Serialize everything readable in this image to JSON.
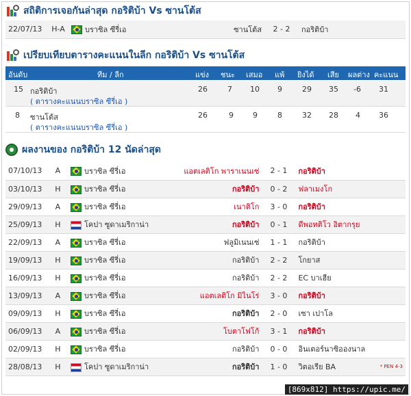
{
  "recent_meeting": {
    "title": "สถิติการเจอกันล่าสุด กอริติบ้า Vs ซานโต้ส",
    "match": {
      "date": "22/07/13",
      "ha": "H-A",
      "league": "บราซิล ซีรี่เอ",
      "home": "ซานโต้ส",
      "score": "2 - 2",
      "away": "กอริติบ้า"
    }
  },
  "standings": {
    "title": "เปรียบเทียบตารางคะแนนในลีก กอริติบ้า Vs ซานโต้ส",
    "headers": {
      "rank": "อันดับ",
      "team": "ทีม / ลีก",
      "played": "แข่ง",
      "win": "ชนะ",
      "draw": "เสมอ",
      "lose": "แพ้",
      "gf": "ยิงได้",
      "ga": "เสีย",
      "gd": "ผลต่าง",
      "pts": "คะแนน"
    },
    "rows": [
      {
        "rank": "15",
        "team": "กอริติบ้า",
        "link": "( ตารางคะแนนบราซิล ซีรี่เอ )",
        "played": "26",
        "win": "7",
        "draw": "10",
        "lose": "9",
        "gf": "29",
        "ga": "35",
        "gd": "-6",
        "pts": "31"
      },
      {
        "rank": "8",
        "team": "ซานโต้ส",
        "link": "( ตารางคะแนนบราซิล ซีรี่เอ )",
        "played": "26",
        "win": "9",
        "draw": "9",
        "lose": "8",
        "gf": "32",
        "ga": "28",
        "gd": "4",
        "pts": "36"
      }
    ]
  },
  "last12": {
    "title": "ผลงานของ กอริติบ้า 12 นัดล่าสุด",
    "rows": [
      {
        "date": "07/10/13",
        "ha": "A",
        "flag": "brazil-flag",
        "league": "บราซิล ซีรี่เอ",
        "home": "แอตเลติโก พาราเนนเซ่",
        "score": "2 - 1",
        "away": "กอริติบ้า",
        "home_style": "red",
        "away_style": "red bold",
        "note": ""
      },
      {
        "date": "03/10/13",
        "ha": "H",
        "flag": "brazil-flag",
        "league": "บราซิล ซีรี่เอ",
        "home": "กอริติบ้า",
        "score": "0 - 2",
        "away": "ฟลาเมงโก",
        "home_style": "red bold",
        "away_style": "red",
        "note": ""
      },
      {
        "date": "29/09/13",
        "ha": "A",
        "flag": "brazil-flag",
        "league": "บราซิล ซีรี่เอ",
        "home": "เนาติโก",
        "score": "3 - 0",
        "away": "กอริติบ้า",
        "home_style": "red",
        "away_style": "red bold",
        "note": ""
      },
      {
        "date": "25/09/13",
        "ha": "H",
        "flag": "copa-flag",
        "league": "โคปา ซูดาเมริกาน่า",
        "home": "กอริติบ้า",
        "score": "0 - 1",
        "away": "ดีพอทติโว อิตากรุย",
        "home_style": "red bold",
        "away_style": "red",
        "note": ""
      },
      {
        "date": "22/09/13",
        "ha": "A",
        "flag": "brazil-flag",
        "league": "บราซิล ซีรี่เอ",
        "home": "ฟลูมิเนนเซ่",
        "score": "1 - 1",
        "away": "กอริติบ้า",
        "home_style": "",
        "away_style": "",
        "note": ""
      },
      {
        "date": "19/09/13",
        "ha": "H",
        "flag": "brazil-flag",
        "league": "บราซิล ซีรี่เอ",
        "home": "กอริติบ้า",
        "score": "2 - 2",
        "away": "โกยาส",
        "home_style": "",
        "away_style": "",
        "note": ""
      },
      {
        "date": "16/09/13",
        "ha": "H",
        "flag": "brazil-flag",
        "league": "บราซิล ซีรี่เอ",
        "home": "กอริติบ้า",
        "score": "2 - 2",
        "away": "EC บาเฮีย",
        "home_style": "",
        "away_style": "",
        "note": ""
      },
      {
        "date": "13/09/13",
        "ha": "A",
        "flag": "brazil-flag",
        "league": "บราซิล ซีรี่เอ",
        "home": "แอตเลติโก มิไนโร่",
        "score": "3 - 0",
        "away": "กอริติบ้า",
        "home_style": "red",
        "away_style": "red bold",
        "note": ""
      },
      {
        "date": "09/09/13",
        "ha": "H",
        "flag": "brazil-flag",
        "league": "บราซิล ซีรี่เอ",
        "home": "กอริติบ้า",
        "score": "2 - 0",
        "away": "เซา เปาโล",
        "home_style": "bold",
        "away_style": "",
        "note": ""
      },
      {
        "date": "06/09/13",
        "ha": "A",
        "flag": "brazil-flag",
        "league": "บราซิล ซีรี่เอ",
        "home": "โบตาโฟโก้",
        "score": "3 - 1",
        "away": "กอริติบ้า",
        "home_style": "red",
        "away_style": "red bold",
        "note": ""
      },
      {
        "date": "02/09/13",
        "ha": "H",
        "flag": "brazil-flag",
        "league": "บราซิล ซีรี่เอ",
        "home": "กอริติบ้า",
        "score": "0 - 0",
        "away": "อินเตอร์นาซิอองนาล",
        "home_style": "",
        "away_style": "",
        "note": ""
      },
      {
        "date": "28/08/13",
        "ha": "H",
        "flag": "copa-flag",
        "league": "โคปา ซูดาเมริกาน่า",
        "home": "กอริติบ้า",
        "score": "1 - 0",
        "away": "วิตอเรีย BA",
        "home_style": "bold",
        "away_style": "",
        "note": "* PEN 4-3"
      }
    ]
  },
  "caption": "[869x812] https://upic.me/",
  "colors": {
    "header_blue": "#1f67b1",
    "title_blue": "#1a4f8b",
    "loss_red": "#d0021b",
    "link_blue": "#1a56b0"
  }
}
